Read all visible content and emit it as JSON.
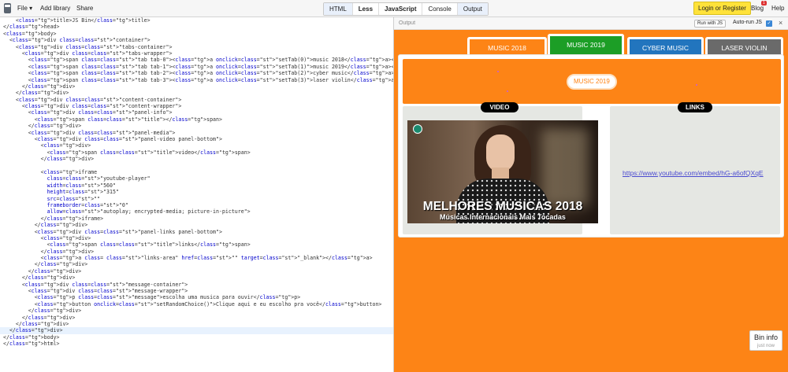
{
  "topbar": {
    "file": "File ▾",
    "add_library": "Add library",
    "share": "Share",
    "tabs": [
      "HTML",
      "Less",
      "JavaScript",
      "Console",
      "Output"
    ],
    "login": "Login or Register",
    "blog": "Blog",
    "blog_badge": "1",
    "help": "Help"
  },
  "editor": {
    "lines": [
      "    <title>JS Bin</title>",
      "</head>",
      "<body>",
      "  <div class=\"container\">",
      "    <div class=\"tabs-container\">",
      "      <div class=\"tabs-wrapper\">",
      "        <span class=\"tab tab-0\"><a onclick=\"setTab(0)\">music 2018</a></span>",
      "        <span class=\"tab tab-1\"><a onclick=\"setTab(1)\">music 2019</a></span>",
      "        <span class=\"tab tab-2\"><a onclick=\"setTab(2)\">cyber music</a></span>",
      "        <span class=\"tab tab-3\"><a onclick=\"setTab(3)\">laser violin</a></span>",
      "      </div>",
      "    </div>",
      "    <div class=\"content-container\">",
      "      <div class=\"content-wrapper\">",
      "        <div class=\"panel-info\">",
      "          <span class=\"title\"></span>",
      "        </div>",
      "        <div class=\"panel-media\">",
      "          <div class=\"panel-video panel-bottom\">",
      "            <div>",
      "              <span class=\"title\">video</span>",
      "            </div>",
      "",
      "            <iframe",
      "              class=\"youtube-player\"",
      "              width=\"560\"",
      "              height=\"315\"",
      "              src=\"\"",
      "              frameborder=\"0\"",
      "              allow=\"autoplay; encrypted-media; picture-in-picture\">",
      "            </iframe>",
      "          </div>",
      "          <div class=\"panel-links panel-bottom\">",
      "            <div>",
      "              <span class=\"title\">links</span>",
      "            </div>",
      "            <a class= \"links-area\" href=\"\" target=\"_blank\"></a>",
      "          </div>",
      "        </div>",
      "      </div>",
      "      <div class=\"message-container\">",
      "        <div class=\"message-wrapper\">",
      "          <p class=\"message\">escolha uma musica para ouvir</p>",
      "          <button onclick=\"setRandomChoice()\">Clique aqui e eu escolho pra você</button>",
      "        </div>",
      "      </div>",
      "    </div>",
      "  </div>",
      "</body>",
      "</html>"
    ],
    "cursor_line": 47
  },
  "output": {
    "label": "Output",
    "run_with_js": "Run with JS",
    "auto_run": "Auto-run JS",
    "close": "×"
  },
  "app": {
    "tabs": [
      "MUSIC 2018",
      "MUSIC 2019",
      "CYBER MUSIC",
      "LASER VIOLIN"
    ],
    "active_tab": 1,
    "hero_pill": "MUSIC 2019",
    "video_title": "VIDEO",
    "links_title": "LINKS",
    "video_thumb_title": "MELHORES MUSICAS 2018",
    "video_thumb_subtitle": "Músicas Internacionais Mais Tocadas",
    "link_url": "https://www.youtube.com/embed/hG-a6ofQXqE"
  },
  "bin_info": {
    "title": "Bin info",
    "subtitle": "just now"
  },
  "colors": {
    "orange": "#fd8416",
    "green": "#1c9e26",
    "blue": "#2275be",
    "gray": "#6a6a6a",
    "link": "#4a4ad0"
  }
}
